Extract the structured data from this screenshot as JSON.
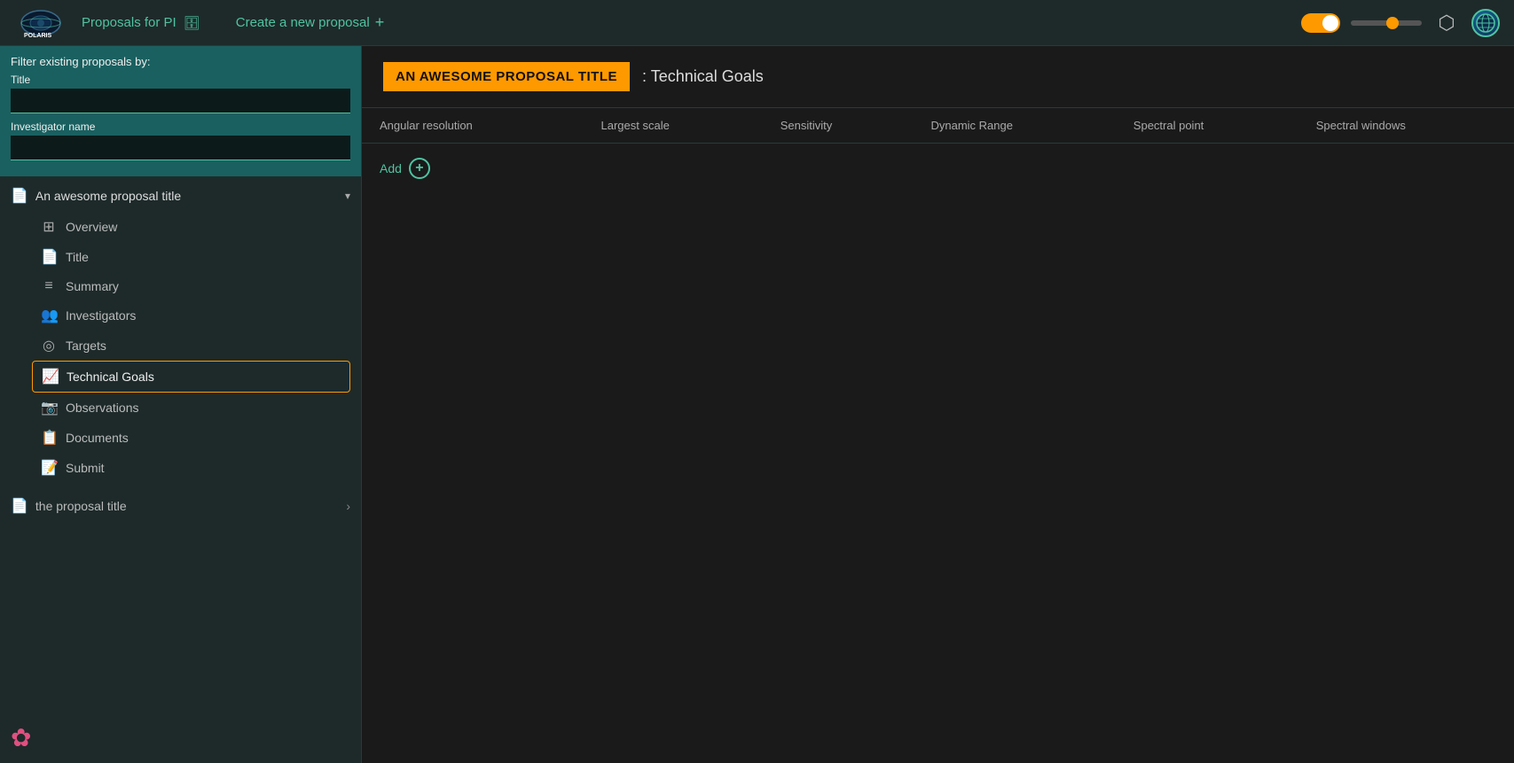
{
  "navbar": {
    "proposals_label": "Proposals for PI",
    "create_label": "Create a new proposal",
    "plus_icon": "+",
    "db_icon": "🗄"
  },
  "filter": {
    "section_label": "Filter existing proposals by:",
    "title_label": "Title",
    "investigator_label": "Investigator name",
    "title_placeholder": "",
    "investigator_placeholder": ""
  },
  "proposals": [
    {
      "id": "proposal-1",
      "title": "An awesome proposal title",
      "expanded": true,
      "nav_items": [
        {
          "id": "overview",
          "label": "Overview",
          "active": false
        },
        {
          "id": "title",
          "label": "Title",
          "active": false
        },
        {
          "id": "summary",
          "label": "Summary",
          "active": false
        },
        {
          "id": "investigators",
          "label": "Investigators",
          "active": false
        },
        {
          "id": "targets",
          "label": "Targets",
          "active": false
        },
        {
          "id": "technical-goals",
          "label": "Technical Goals",
          "active": true
        },
        {
          "id": "observations",
          "label": "Observations",
          "active": false
        },
        {
          "id": "documents",
          "label": "Documents",
          "active": false
        },
        {
          "id": "submit",
          "label": "Submit",
          "active": false
        }
      ]
    },
    {
      "id": "proposal-2",
      "title": "the proposal title",
      "expanded": false
    }
  ],
  "content": {
    "badge_text": "AN AWESOME PROPOSAL TITLE",
    "section_title": ": Technical Goals",
    "table": {
      "columns": [
        "Angular resolution",
        "Largest scale",
        "Sensitivity",
        "Dynamic Range",
        "Spectral point",
        "Spectral windows"
      ],
      "add_label": "Add"
    }
  },
  "icons": {
    "overview": "⊞",
    "title": "📄",
    "summary": "≡",
    "investigators": "👥",
    "targets": "◎",
    "technical_goals": "📈",
    "observations": "📷",
    "documents": "📋",
    "submit": "📄",
    "chevron_down": "▾",
    "chevron_right": "›",
    "plus": "+",
    "flower": "✿"
  }
}
